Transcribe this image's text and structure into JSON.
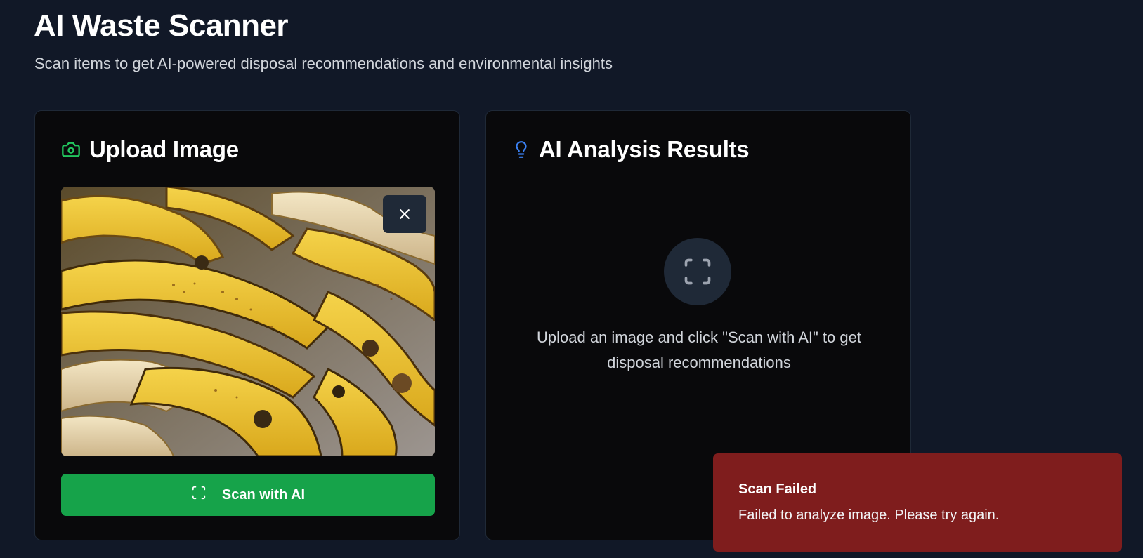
{
  "header": {
    "title": "AI Waste Scanner",
    "subtitle": "Scan items to get AI-powered disposal recommendations and environmental insights"
  },
  "upload_card": {
    "title": "Upload Image",
    "icon": "camera-icon",
    "image_subject": "banana peels",
    "remove_icon": "close-icon",
    "scan_button_label": "Scan with AI",
    "scan_button_icon": "scan-icon"
  },
  "results_card": {
    "title": "AI Analysis Results",
    "icon": "lightbulb-icon",
    "empty_icon": "scan-icon",
    "empty_message": "Upload an image and click \"Scan with AI\" to get disposal recommendations"
  },
  "toast": {
    "title": "Scan Failed",
    "message": "Failed to analyze image. Please try again."
  },
  "colors": {
    "background": "#111827",
    "card": "#09090b",
    "accent_green": "#16a34a",
    "accent_blue": "#3b82f6",
    "toast_error": "#7f1d1d"
  }
}
